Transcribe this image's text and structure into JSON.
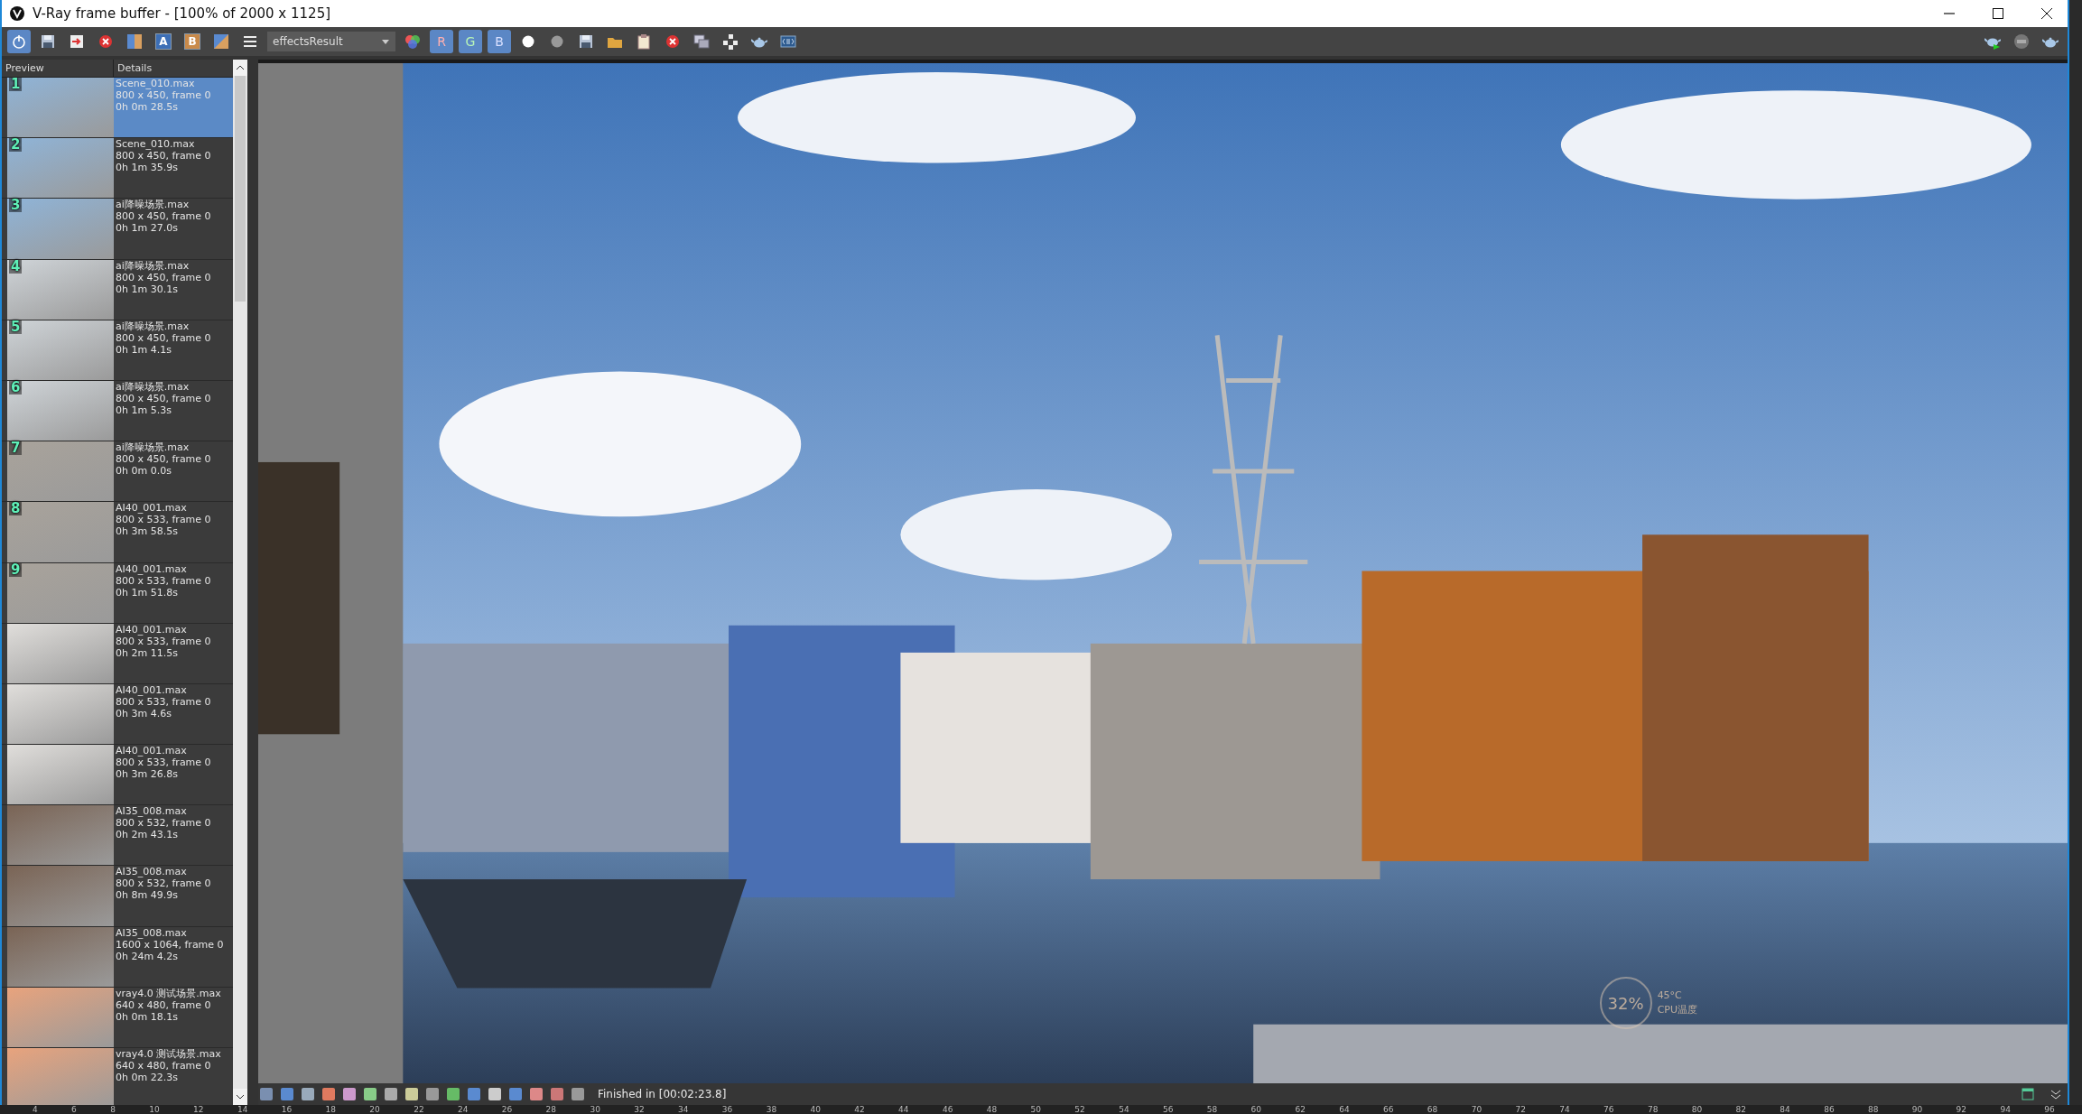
{
  "window": {
    "title": "V-Ray frame buffer - [100% of 2000 x 1125]"
  },
  "toolbar": {
    "power_on": true,
    "letter_buttons": [
      {
        "label": "A"
      },
      {
        "label": "B"
      }
    ],
    "channel": {
      "value": "effectsResult"
    },
    "rgb": [
      {
        "label": "R",
        "selected": true
      },
      {
        "label": "G",
        "selected": true
      },
      {
        "label": "B",
        "selected": true
      }
    ]
  },
  "history": {
    "columns": [
      "Preview",
      "Details"
    ],
    "rows": [
      {
        "number": "1",
        "file": "Scene_010.max",
        "size": "800 x 450, frame 0",
        "time": "0h 0m 28.5s",
        "selected": true
      },
      {
        "number": "2",
        "file": "Scene_010.max",
        "size": "800 x 450, frame 0",
        "time": "0h 1m 35.9s",
        "selected": false
      },
      {
        "number": "3",
        "file": "ai降噪场景.max",
        "size": "800 x 450, frame 0",
        "time": "0h 1m 27.0s",
        "selected": false
      },
      {
        "number": "4",
        "file": "ai降噪场景.max",
        "size": "800 x 450, frame 0",
        "time": "0h 1m 30.1s",
        "selected": false
      },
      {
        "number": "5",
        "file": "ai降噪场景.max",
        "size": "800 x 450, frame 0",
        "time": "0h 1m 4.1s",
        "selected": false
      },
      {
        "number": "6",
        "file": "ai降噪场景.max",
        "size": "800 x 450, frame 0",
        "time": "0h 1m 5.3s",
        "selected": false
      },
      {
        "number": "7",
        "file": "ai降噪场景.max",
        "size": "800 x 450, frame 0",
        "time": "0h 0m 0.0s",
        "selected": false
      },
      {
        "number": "8",
        "file": "AI40_001.max",
        "size": "800 x 533, frame 0",
        "time": "0h 3m 58.5s",
        "selected": false
      },
      {
        "number": "9",
        "file": "AI40_001.max",
        "size": "800 x 533, frame 0",
        "time": "0h 1m 51.8s",
        "selected": false
      },
      {
        "file": "AI40_001.max",
        "size": "800 x 533, frame 0",
        "time": "0h 2m 11.5s",
        "selected": false
      },
      {
        "file": "AI40_001.max",
        "size": "800 x 533, frame 0",
        "time": "0h 3m 4.6s",
        "selected": false
      },
      {
        "file": "AI40_001.max",
        "size": "800 x 533, frame 0",
        "time": "0h 3m 26.8s",
        "selected": false
      },
      {
        "file": "AI35_008.max",
        "size": "800 x 532, frame 0",
        "time": "0h 2m 43.1s",
        "selected": false
      },
      {
        "file": "AI35_008.max",
        "size": "800 x 532, frame 0",
        "time": "0h 8m 49.9s",
        "selected": false
      },
      {
        "file": "AI35_008.max",
        "size": "1600 x 1064, frame 0",
        "time": "0h 24m 4.2s",
        "selected": false
      },
      {
        "file": "vray4.0 测试场景.max",
        "size": "640 x 480, frame 0",
        "time": "0h 0m 18.1s",
        "selected": false
      },
      {
        "file": "vray4.0 测试场景.max",
        "size": "640 x 480, frame 0",
        "time": "0h 0m 22.3s",
        "selected": false
      }
    ]
  },
  "cpu_widget": {
    "percent": "32%",
    "temperature": "45°C",
    "label": "CPU温度"
  },
  "status_bar": {
    "message": "Finished in [00:02:23.8]"
  },
  "timeline": {
    "ticks": [
      "4",
      "6",
      "8",
      "10",
      "12",
      "14",
      "16",
      "18",
      "20",
      "22",
      "24",
      "26",
      "28",
      "30",
      "32",
      "34",
      "36",
      "38",
      "40",
      "42",
      "44",
      "46",
      "48",
      "50",
      "52",
      "54",
      "56",
      "58",
      "60",
      "62",
      "64",
      "66",
      "68",
      "70",
      "72",
      "74",
      "76",
      "78",
      "80",
      "82",
      "84",
      "86",
      "88",
      "90",
      "92",
      "94",
      "96"
    ]
  }
}
